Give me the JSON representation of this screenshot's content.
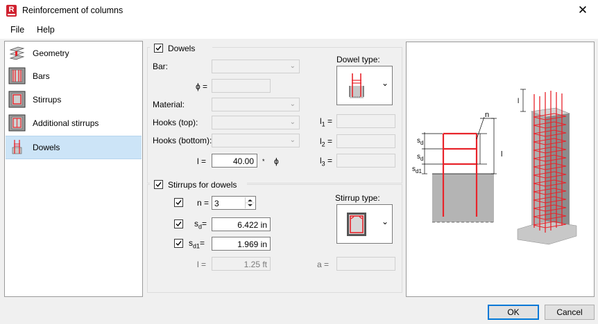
{
  "window": {
    "title": "Reinforcement of columns",
    "app_icon_letter": "R",
    "close_glyph": "✕"
  },
  "menu": {
    "file": "File",
    "help": "Help"
  },
  "nav": [
    {
      "label": "Geometry",
      "icon": "geometry-icon"
    },
    {
      "label": "Bars",
      "icon": "bars-icon"
    },
    {
      "label": "Stirrups",
      "icon": "stirrups-icon"
    },
    {
      "label": "Additional stirrups",
      "icon": "additional-stirrups-icon"
    },
    {
      "label": "Dowels",
      "icon": "dowels-icon",
      "selected": true
    }
  ],
  "dowels": {
    "group_label": "Dowels",
    "checked": true,
    "bar_label": "Bar:",
    "phi_label": "ϕ =",
    "material_label": "Material:",
    "hooks_top_label": "Hooks (top):",
    "hooks_bottom_label": "Hooks (bottom):",
    "l_label": "l =",
    "l_value": "40.00",
    "l_unit_sep": "*",
    "l_unit_phi": "ϕ",
    "dowel_type_label": "Dowel type:",
    "l1_label": "l",
    "l1_sub": "1",
    "l2_label": "l",
    "l2_sub": "2",
    "l3_label": "l",
    "l3_sub": "3",
    "eq": "="
  },
  "stirrups_for_dowels": {
    "group_label": "Stirrups for dowels",
    "checked": true,
    "n_label": "n =",
    "n_value": "3",
    "n_checked": true,
    "sd_label": "s",
    "sd_sub": "d",
    "sd_value": "6.422 in",
    "sd_checked": true,
    "sd1_label": "s",
    "sd1_sub": "d1",
    "sd1_value": "1.969 in",
    "sd1_checked": true,
    "eq": "=",
    "l_label": "l =",
    "l_value": "1.25 ft",
    "a_label": "a =",
    "stirrup_type_label": "Stirrup type:"
  },
  "preview": {
    "n_label": "n",
    "sd_label_1": "s",
    "sd_sub_1": "d",
    "sd_label_2": "s",
    "sd_sub_2": "d",
    "sd1_label": "s",
    "sd1_sub": "d1",
    "l_label": "l",
    "l_label_3d": "l"
  },
  "buttons": {
    "ok": "OK",
    "cancel": "Cancel"
  },
  "colors": {
    "rebar": "#e8242b",
    "concrete": "#b4b4b4",
    "selection": "#cce4f7",
    "accent": "#0078d7"
  }
}
